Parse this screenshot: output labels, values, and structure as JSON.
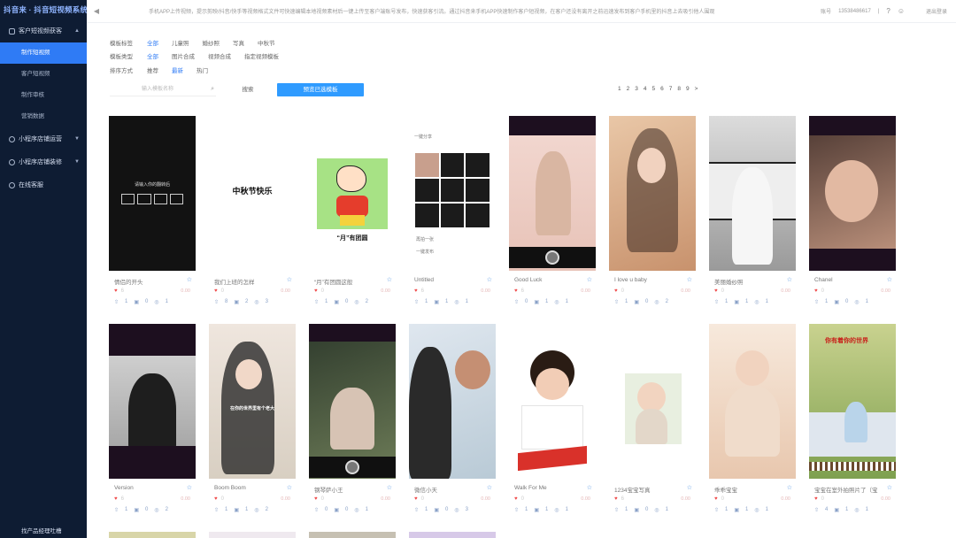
{
  "app": {
    "title": "抖音来 · 抖音短视频系统"
  },
  "sidebar": {
    "groups": [
      {
        "label": "客户短视频获客",
        "expanded": true,
        "items": [
          {
            "label": "制作短视频",
            "active": true
          },
          {
            "label": "客户短视频",
            "active": false
          },
          {
            "label": "制作审核",
            "active": false
          },
          {
            "label": "营销数据",
            "active": false
          }
        ]
      },
      {
        "label": "小程序店铺运营",
        "expanded": false,
        "items": []
      },
      {
        "label": "小程序店铺装修",
        "expanded": false,
        "items": []
      },
      {
        "label": "在线客服",
        "expanded": false,
        "items": []
      }
    ],
    "footer": "找产品经理吐槽"
  },
  "header": {
    "notice": "手机APP上传视频，提示剪映/抖音/快手等视频格式文件可快速编辑本地视频素材后一键上传至客户端账号发布，快速获客引流。通过抖音来手机APP快速制作客户短视频，在客户还没有离开之前迅速发布到客户手机里的抖音上去吸引他人围观",
    "sep": "|",
    "account_label": "账号",
    "phone": "13538486617",
    "logout": "退出登录"
  },
  "filters": {
    "tag": {
      "label": "模板标签",
      "options": [
        "全部",
        "儿童照",
        "婚纱照",
        "写真",
        "中秋节"
      ],
      "selected": 0
    },
    "type": {
      "label": "模板类型",
      "options": [
        "全部",
        "图片合成",
        "视频合成",
        "指定视频模板"
      ],
      "selected": 0
    },
    "sort": {
      "label": "排序方式",
      "options": [
        "推荐",
        "最新",
        "热门"
      ],
      "selected": 1
    }
  },
  "search": {
    "placeholder": "输入模板名称",
    "button": "搜索",
    "preview_button": "预览已选模板"
  },
  "pagination": {
    "pages": [
      "1",
      "2",
      "3",
      "4",
      "5",
      "6",
      "7",
      "8",
      "9"
    ],
    "next": ">"
  },
  "cards": [
    {
      "title": "情侣的开头",
      "likes": "6",
      "price": "0.00",
      "uses": "1",
      "shares": "0",
      "views": "1"
    },
    {
      "title": "我们上班的怎样",
      "likes": "0",
      "price": "0.00",
      "uses": "8",
      "shares": "2",
      "views": "3"
    },
    {
      "title": "“月”有团圆这般",
      "likes": "0",
      "price": "0.00",
      "uses": "1",
      "shares": "0",
      "views": "2"
    },
    {
      "title": "Untitled",
      "likes": "6",
      "price": "0.00",
      "uses": "1",
      "shares": "1",
      "views": "1"
    },
    {
      "title": "Good Luck",
      "likes": "6",
      "price": "0.00",
      "uses": "0",
      "shares": "1",
      "views": "1"
    },
    {
      "title": "I love u baby",
      "likes": "0",
      "price": "0.00",
      "uses": "1",
      "shares": "0",
      "views": "2"
    },
    {
      "title": "美丽婚纱照",
      "likes": "0",
      "price": "0.00",
      "uses": "1",
      "shares": "1",
      "views": "1"
    },
    {
      "title": "Chanel",
      "likes": "0",
      "price": "0.00",
      "uses": "1",
      "shares": "0",
      "views": "1"
    },
    {
      "title": "Version",
      "likes": "6",
      "price": "0.00",
      "uses": "1",
      "shares": "0",
      "views": "2"
    },
    {
      "title": "Boom Boom",
      "likes": "0",
      "price": "0.00",
      "uses": "1",
      "shares": "1",
      "views": "2"
    },
    {
      "title": "钢琴萨小王",
      "likes": "0",
      "price": "0.00",
      "uses": "0",
      "shares": "0",
      "views": "1"
    },
    {
      "title": "微信小天",
      "likes": "0",
      "price": "0.00",
      "uses": "1",
      "shares": "0",
      "views": "3"
    },
    {
      "title": "Walk For Me",
      "likes": "0",
      "price": "0.00",
      "uses": "1",
      "shares": "1",
      "views": "1"
    },
    {
      "title": "1234宝宝写真",
      "likes": "6",
      "price": "0.00",
      "uses": "1",
      "shares": "0",
      "views": "1"
    },
    {
      "title": "乖乖宝宝",
      "likes": "0",
      "price": "0.00",
      "uses": "1",
      "shares": "1",
      "views": "1"
    },
    {
      "title": "宝宝在室外拍照片了（宝宝",
      "likes": "0",
      "price": "0.00",
      "uses": "4",
      "shares": "1",
      "views": "1"
    }
  ],
  "overlays": {
    "dark_caption": "请输入你的翻转后",
    "mid_autumn": "中秋节快乐",
    "moon_text": "“月”有团圆",
    "untitled_caption": "一键分享",
    "untitled_item1": "再拍一张",
    "untitled_item2": "一键发布",
    "boom_caption": "在你的世界里有个老大",
    "field_caption": "你有着你的世界"
  }
}
